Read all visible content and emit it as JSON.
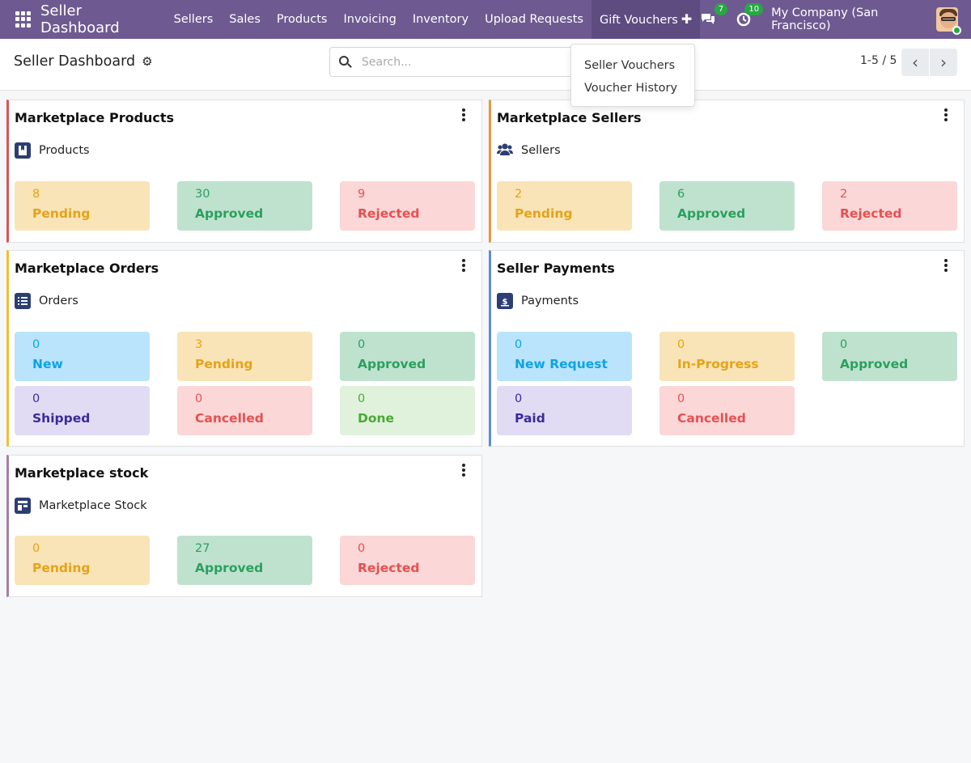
{
  "navbar": {
    "brand": "Seller Dashboard",
    "menu": [
      "Sellers",
      "Sales",
      "Products",
      "Invoicing",
      "Inventory",
      "Upload Requests",
      "Gift Vouchers"
    ],
    "chat_count": "7",
    "activity_count": "10",
    "company": "My Company (San Francisco)"
  },
  "control": {
    "title": "Seller Dashboard",
    "search_placeholder": "Search...",
    "pager": "1-5 / 5"
  },
  "dropdown": {
    "items": [
      "Seller Vouchers",
      "Voucher History"
    ]
  },
  "cards": [
    {
      "title": "Marketplace Products",
      "subtitle": "Products",
      "accent": "#e05252",
      "stats": [
        {
          "num": "8",
          "label": "Pending"
        },
        {
          "num": "30",
          "label": "Approved"
        },
        {
          "num": "9",
          "label": "Rejected"
        }
      ]
    },
    {
      "title": "Marketplace Sellers",
      "subtitle": "Sellers",
      "accent": "#e8963c",
      "stats": [
        {
          "num": "2",
          "label": "Pending"
        },
        {
          "num": "6",
          "label": "Approved"
        },
        {
          "num": "2",
          "label": "Rejected"
        }
      ]
    },
    {
      "title": "Marketplace Orders",
      "subtitle": "Orders",
      "accent": "#f0c030",
      "stats": [
        {
          "num": "0",
          "label": "New"
        },
        {
          "num": "3",
          "label": "Pending"
        },
        {
          "num": "0",
          "label": "Approved"
        },
        {
          "num": "0",
          "label": "Shipped"
        },
        {
          "num": "0",
          "label": "Cancelled"
        },
        {
          "num": "0",
          "label": "Done"
        }
      ]
    },
    {
      "title": "Seller Payments",
      "subtitle": "Payments",
      "accent": "#5b8fd6",
      "stats": [
        {
          "num": "0",
          "label": "New Request"
        },
        {
          "num": "0",
          "label": "In-Progress"
        },
        {
          "num": "0",
          "label": "Approved"
        },
        {
          "num": "0",
          "label": "Paid"
        },
        {
          "num": "0",
          "label": "Cancelled"
        }
      ]
    },
    {
      "title": "Marketplace stock",
      "subtitle": "Marketplace Stock",
      "accent": "#a77fa8",
      "stats": [
        {
          "num": "0",
          "label": "Pending"
        },
        {
          "num": "27",
          "label": "Approved"
        },
        {
          "num": "0",
          "label": "Rejected"
        }
      ]
    }
  ],
  "colors": {
    "navbar": "#6e5a91",
    "pending": "#e4a318",
    "approved": "#2ba05d",
    "rejected": "#e65050",
    "new": "#0da3e6",
    "shipped": "#3a2b9b",
    "done": "#4aa935"
  }
}
